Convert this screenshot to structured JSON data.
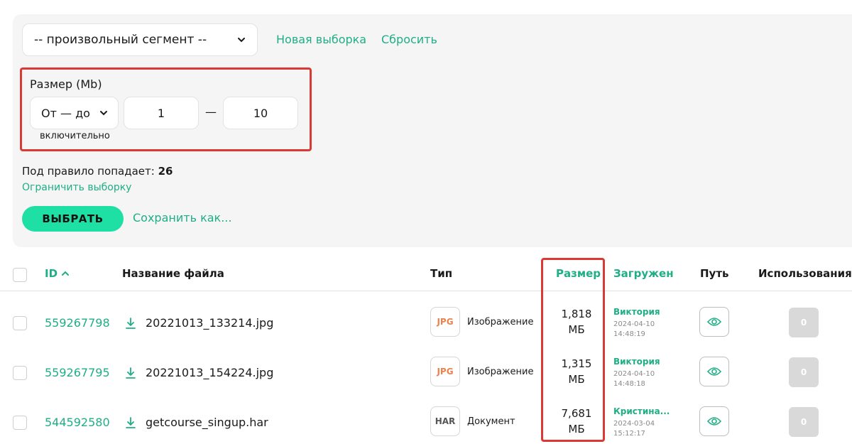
{
  "filter": {
    "segment_value": "-- произвольный сегмент --",
    "new_selection_label": "Новая выборка",
    "reset_label": "Сбросить",
    "size_label": "Размер (Mb)",
    "range_mode_value": "От — до",
    "from_value": "1",
    "range_separator": "—",
    "to_value": "10",
    "inclusive_label": "включительно",
    "rule_count_label": "Под правило попадает:",
    "rule_count_value": "26",
    "limit_label": "Ограничить выборку",
    "select_button_label": "ВЫБРАТЬ",
    "save_as_label": "Сохранить как..."
  },
  "table": {
    "headers": {
      "id": "ID",
      "filename": "Название файла",
      "type": "Тип",
      "size": "Размер",
      "uploaded": "Загружен",
      "path": "Путь",
      "usages": "Использования"
    },
    "rows": [
      {
        "id": "559267798",
        "filename": "20221013_133214.jpg",
        "type_code": "JPG",
        "type_color": "#e8834f",
        "type_name": "Изображение",
        "size_num": "1,818",
        "size_unit": "МБ",
        "user": "Виктория",
        "date": "2024-04-10",
        "time": "14:48:19",
        "usages": "0"
      },
      {
        "id": "559267795",
        "filename": "20221013_154224.jpg",
        "type_code": "JPG",
        "type_color": "#e8834f",
        "type_name": "Изображение",
        "size_num": "1,315",
        "size_unit": "МБ",
        "user": "Виктория",
        "date": "2024-04-10",
        "time": "14:48:18",
        "usages": "0"
      },
      {
        "id": "544592580",
        "filename": "getcourse_singup.har",
        "type_code": "HAR",
        "type_color": "#555555",
        "type_name": "Документ",
        "size_num": "7,681",
        "size_unit": "МБ",
        "user": "Кристина...",
        "date": "2024-03-04",
        "time": "15:12:17",
        "usages": "0"
      }
    ]
  },
  "colors": {
    "accent": "#1fae85",
    "button": "#1fe0a4",
    "highlight": "#d93a34"
  }
}
